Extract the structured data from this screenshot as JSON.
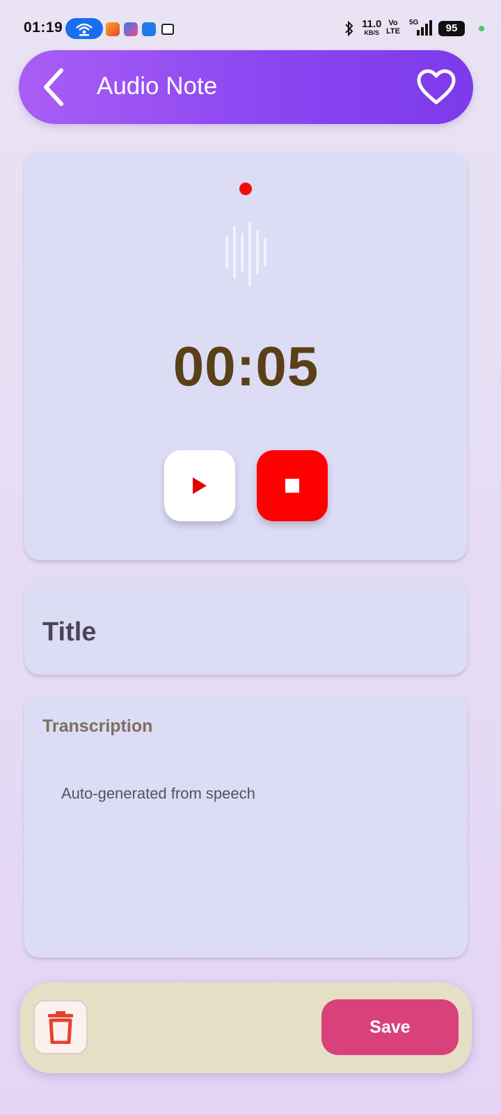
{
  "status_bar": {
    "time": "01:19",
    "net_speed": "11.0",
    "net_unit": "KB/S",
    "volte_top": "Vo",
    "volte_bottom": "LTE",
    "network": "5G",
    "battery": "95",
    "hotspot_icon": "hotspot-icon",
    "bluetooth_icon": "bluetooth-icon"
  },
  "header": {
    "title": "Audio Note",
    "back_icon": "chevron-left-icon",
    "favorite_icon": "heart-outline-icon"
  },
  "recorder": {
    "timer": "00:05",
    "recording_indicator_color": "#f20d0d",
    "play_icon": "play-icon",
    "stop_icon": "stop-icon"
  },
  "title_field": {
    "placeholder": "Title"
  },
  "transcription": {
    "label": "Transcription",
    "placeholder": "Auto-generated from speech"
  },
  "bottom_bar": {
    "delete_icon": "trash-icon",
    "save_label": "Save"
  },
  "colors": {
    "header_gradient_start": "#a95ef5",
    "header_gradient_end": "#7d3aeb",
    "card_bg": "#dcdcf5",
    "stop_button": "#ff0000",
    "save_button": "#d9417a",
    "timer_text": "#5a4018"
  }
}
